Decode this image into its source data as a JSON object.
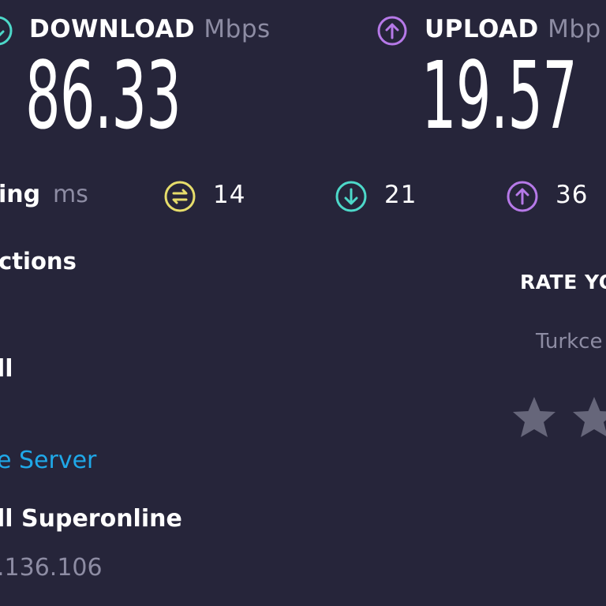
{
  "download": {
    "label": "DOWNLOAD",
    "unit": "Mbps",
    "value": "86.33",
    "icon": "download-circle-icon",
    "color": "#4dd8c9"
  },
  "upload": {
    "label": "UPLOAD",
    "unit": "Mbp",
    "value": "19.57",
    "icon": "upload-circle-icon",
    "color": "#b679e8"
  },
  "ping": {
    "label": "ing",
    "unit": "ms",
    "idle": {
      "value": "14",
      "icon": "ping-idle-icon",
      "color": "#e6dd6b"
    },
    "download": {
      "value": "21",
      "icon": "ping-download-icon",
      "color": "#4dd8c9"
    },
    "upload": {
      "value": "36",
      "icon": "ping-upload-icon",
      "color": "#b679e8"
    }
  },
  "connections": {
    "heading": "ctions",
    "mode": "ll",
    "change_server": "e Server",
    "isp": "ll Superonline",
    "ip": ".136.106"
  },
  "rating": {
    "title": "RATE YO",
    "provider": "Turkce",
    "stars_visible": 2,
    "star_color": "#66667a"
  }
}
